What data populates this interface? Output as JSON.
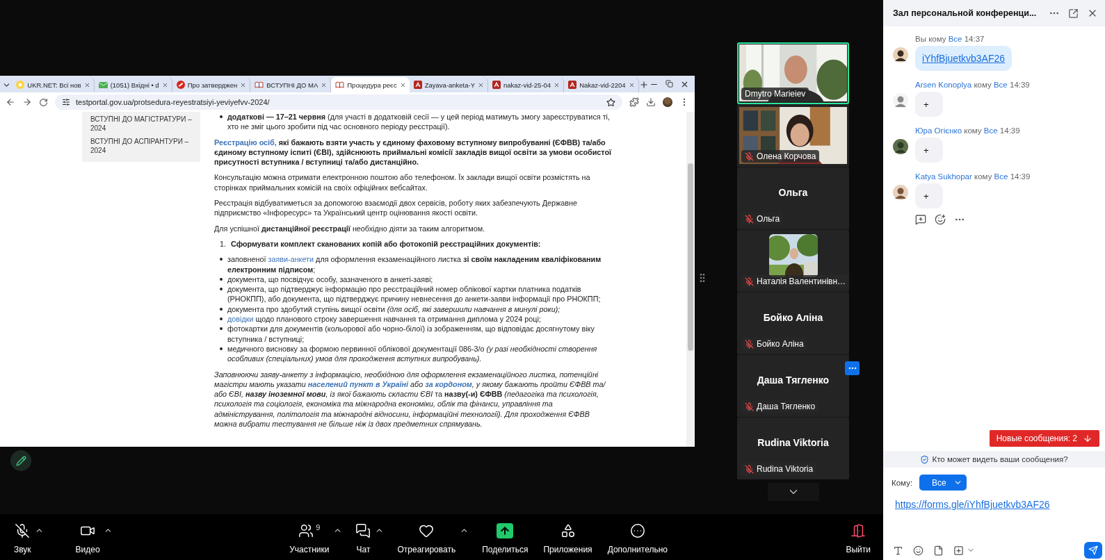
{
  "browser": {
    "tabs": [
      {
        "label": "UKR.NET: Всі нов",
        "kind": "page",
        "selected": false
      },
      {
        "label": "(1051) Вхідні • d",
        "kind": "page",
        "selected": false
      },
      {
        "label": "Про затверджен",
        "kind": "page",
        "selected": false
      },
      {
        "label": "ВСТУПНІ ДО МА",
        "kind": "page",
        "selected": false
      },
      {
        "label": "Процедура реєс",
        "kind": "page",
        "selected": true
      },
      {
        "label": "Zayava-anketa-Y",
        "kind": "pdf",
        "selected": false
      },
      {
        "label": "nakaz-vid-25-04",
        "kind": "pdf",
        "selected": false
      },
      {
        "label": "Nakaz-vid-2204",
        "kind": "pdf",
        "selected": false
      }
    ],
    "address": "testportal.gov.ua/protsedura-reyestratsiyi-yeviyefvv-2024/",
    "sidebar": [
      "ВСТУПНІ ДО МАГІСТРАТУРИ – 2024",
      "ВСТУПНІ ДО АСПІРАНТУРИ – 2024"
    ],
    "content": [
      {
        "kind": "bullet",
        "segments": [
          {
            "kind": "bold",
            "text": "додаткові — 17–21 червня"
          },
          {
            "kind": "plain",
            "text": " (для участі в додатковій сесії — у цей період матимуть змогу зареєструватися ті, хто не зміг цього зробити під час основного періоду реєстрації)."
          }
        ]
      },
      {
        "kind": "paragraph",
        "segments": [
          {
            "kind": "bold-link",
            "text": "Реєстрацію осіб,"
          },
          {
            "kind": "bold",
            "text": " які бажають взяти участь у єдиному фаховому вступному випробуванні (ЄФВВ) та/або єдиному вступному іспиті (ЄВІ),  здійснюють приймальні комісії закладів вищої освіти за умови особистої присутності вступника / вступниці та/або дистанційно."
          }
        ]
      },
      {
        "kind": "paragraph",
        "segments": [
          {
            "kind": "plain",
            "text": "Консультацію можна отримати електронною поштою або телефоном. Їх заклади вищої освіти розмістять на сторінках приймальних комісій на своїх офіційних вебсайтах."
          }
        ]
      },
      {
        "kind": "paragraph",
        "segments": [
          {
            "kind": "plain",
            "text": "Реєстрація відбуватиметься за допомогою взаємодії двох сервісів, роботу яких забезпечують Державне підприємство «Інфоресурс» та Український центр оцінювання якості освіти."
          }
        ]
      },
      {
        "kind": "paragraph",
        "segments": [
          {
            "kind": "plain",
            "text": "Для успішної "
          },
          {
            "kind": "bold",
            "text": "дистанційної реєстрації"
          },
          {
            "kind": "plain",
            "text": " необхідно діяти за таким алгоритмом."
          }
        ]
      },
      {
        "kind": "numbered",
        "number": "1.",
        "segments": [
          {
            "kind": "bold",
            "text": "Сформувати комплект сканованих копій або фотокопій реєстраційних документів:"
          }
        ]
      },
      {
        "kind": "bullet",
        "segments": [
          {
            "kind": "plain",
            "text": "заповненої "
          },
          {
            "kind": "link",
            "text": "заяви-анкети"
          },
          {
            "kind": "plain",
            "text": " для оформлення екзаменаційного листка "
          },
          {
            "kind": "bold",
            "text": "зі своїм накладеним кваліфікованим електронним підписом"
          },
          {
            "kind": "plain",
            "text": ";"
          }
        ]
      },
      {
        "kind": "bullet",
        "segments": [
          {
            "kind": "plain",
            "text": "документа, що посвідчує особу, зазначеного в анкеті-заяві;"
          }
        ]
      },
      {
        "kind": "bullet",
        "segments": [
          {
            "kind": "plain",
            "text": "документа, що підтверджує інформацію про  реєстраційний номер облікової картки платника податків (РНОКПП), або документа, що підтверджує причину невнесення до анкети-заяви інформації про РНОКПП;"
          }
        ]
      },
      {
        "kind": "bullet",
        "segments": [
          {
            "kind": "plain",
            "text": "документа про здобутий ступінь вищої освіти "
          },
          {
            "kind": "italic",
            "text": "(для осіб, які завершили навчання в минулі роки);"
          }
        ]
      },
      {
        "kind": "bullet",
        "segments": [
          {
            "kind": "link",
            "text": "довідки"
          },
          {
            "kind": "plain",
            "text": " щодо планового строку завершення навчання та отримання диплома у 2024 році;"
          }
        ]
      },
      {
        "kind": "bullet",
        "segments": [
          {
            "kind": "plain",
            "text": "фотокартки для документів (кольорової або чорно-білої) із зображенням, що відповідає досягнутому віку вступника / вступниці;"
          }
        ]
      },
      {
        "kind": "bullet",
        "segments": [
          {
            "kind": "plain",
            "text": "медичного висновку за формою первинної облікової документації 086-3/о "
          },
          {
            "kind": "italic",
            "text": "(у разі необхідності створення особливих (спеціальних) умов для проходження вступних випробувань)."
          }
        ]
      },
      {
        "kind": "note",
        "segments": [
          {
            "kind": "plain",
            "text": "Заповнюючи заяву-анкету з інформацією, необхідною для оформлення екзаменаційного листка, потенційні магістри мають указати "
          },
          {
            "kind": "bold-link",
            "text": "населений пункт в Україні"
          },
          {
            "kind": "plain",
            "text": " або "
          },
          {
            "kind": "bold-link",
            "text": "за кордоном"
          },
          {
            "kind": "plain",
            "text": ",  у якому бажають пройти ЄФВВ та/або ЄВІ, "
          },
          {
            "kind": "bold",
            "text": "назву іноземної мови"
          },
          {
            "kind": "plain",
            "text": ", із якої бажають скласти ЄВІ "
          },
          {
            "kind": "upright",
            "text": "та "
          },
          {
            "kind": "bold-upright",
            "text": "назву(-и) ЄФВВ"
          },
          {
            "kind": "plain",
            "text": " (педагогіка та психологія, психологія та соціологія, економіка та міжнародна економіки, облік та фінанси, управління та адміністрування, політологія та міжнародні відносини, інформаційні технології). Для проходження ЄФВВ можна вибрати тестування не більше ніж із двох предметних спрямувань."
          }
        ]
      }
    ]
  },
  "participants": [
    {
      "kind": "video",
      "name": "Dmytro Marieiev",
      "muted": false,
      "speaking": true,
      "menu": false
    },
    {
      "kind": "video",
      "name": "Олена Корчова",
      "muted": true,
      "speaking": false,
      "menu": false
    },
    {
      "kind": "name",
      "title": "Ольга",
      "name": "Ольга",
      "muted": true,
      "speaking": false,
      "menu": false
    },
    {
      "name": "Наталія Валентинівн…",
      "muted": true,
      "speaking": false,
      "menu": false
    },
    {
      "kind": "name",
      "title": "Бойко Аліна",
      "name": "Бойко Аліна",
      "muted": true,
      "speaking": false,
      "menu": false
    },
    {
      "kind": "name",
      "title": "Даша Тягленко",
      "name": "Даша Тягленко",
      "muted": true,
      "speaking": false,
      "menu": true
    },
    {
      "kind": "name",
      "title": "Rudina Viktoria",
      "name": "Rudina Viktoria",
      "muted": true,
      "speaking": false,
      "menu": false
    }
  ],
  "toolbar": [
    {
      "kind": "audio",
      "label": "Звук",
      "muted": true,
      "caret": true
    },
    {
      "kind": "video",
      "label": "Видео",
      "caret": true
    },
    {
      "kind": "participants",
      "label": "Участники",
      "count": "9",
      "caret": true
    },
    {
      "kind": "chat",
      "label": "Чат",
      "caret": true
    },
    {
      "kind": "react",
      "label": "Отреагировать",
      "caret": true
    },
    {
      "kind": "share",
      "label": "Поделиться",
      "caret": false
    },
    {
      "kind": "apps",
      "label": "Приложения",
      "caret": false
    },
    {
      "kind": "more",
      "label": "Дополнительно",
      "caret": false
    },
    {
      "kind": "leave",
      "label": "Выйти",
      "caret": false
    }
  ],
  "chat": {
    "title": "Зал персональной конференци...",
    "messages": [
      {
        "kind": "self",
        "sender": "Вы",
        "to": "кому",
        "recipient": "Все",
        "time": "14:37",
        "text": "iYhfBjuetkvb3AF26",
        "link": true
      },
      {
        "kind": "other",
        "sender": "Arsen Konoplya",
        "to": "кому",
        "recipient": "Все",
        "time": "14:39",
        "text": "+",
        "link": false
      },
      {
        "kind": "other",
        "sender": "Юра Огієнко",
        "to": "кому",
        "recipient": "Все",
        "time": "14:39",
        "text": "+",
        "link": false
      },
      {
        "kind": "other",
        "sender": "Katya Sukhopar",
        "to": "кому",
        "recipient": "Все",
        "time": "14:39",
        "text": "+",
        "link": false
      }
    ],
    "new_messages": "Новые сообщения: 2",
    "privacy": "Кто может видеть ваши сообщения?",
    "compose": {
      "to_label": "Кому:",
      "recipient": "Все",
      "value": "https://forms.gle/iYhfBjuetkvb3AF26"
    }
  }
}
